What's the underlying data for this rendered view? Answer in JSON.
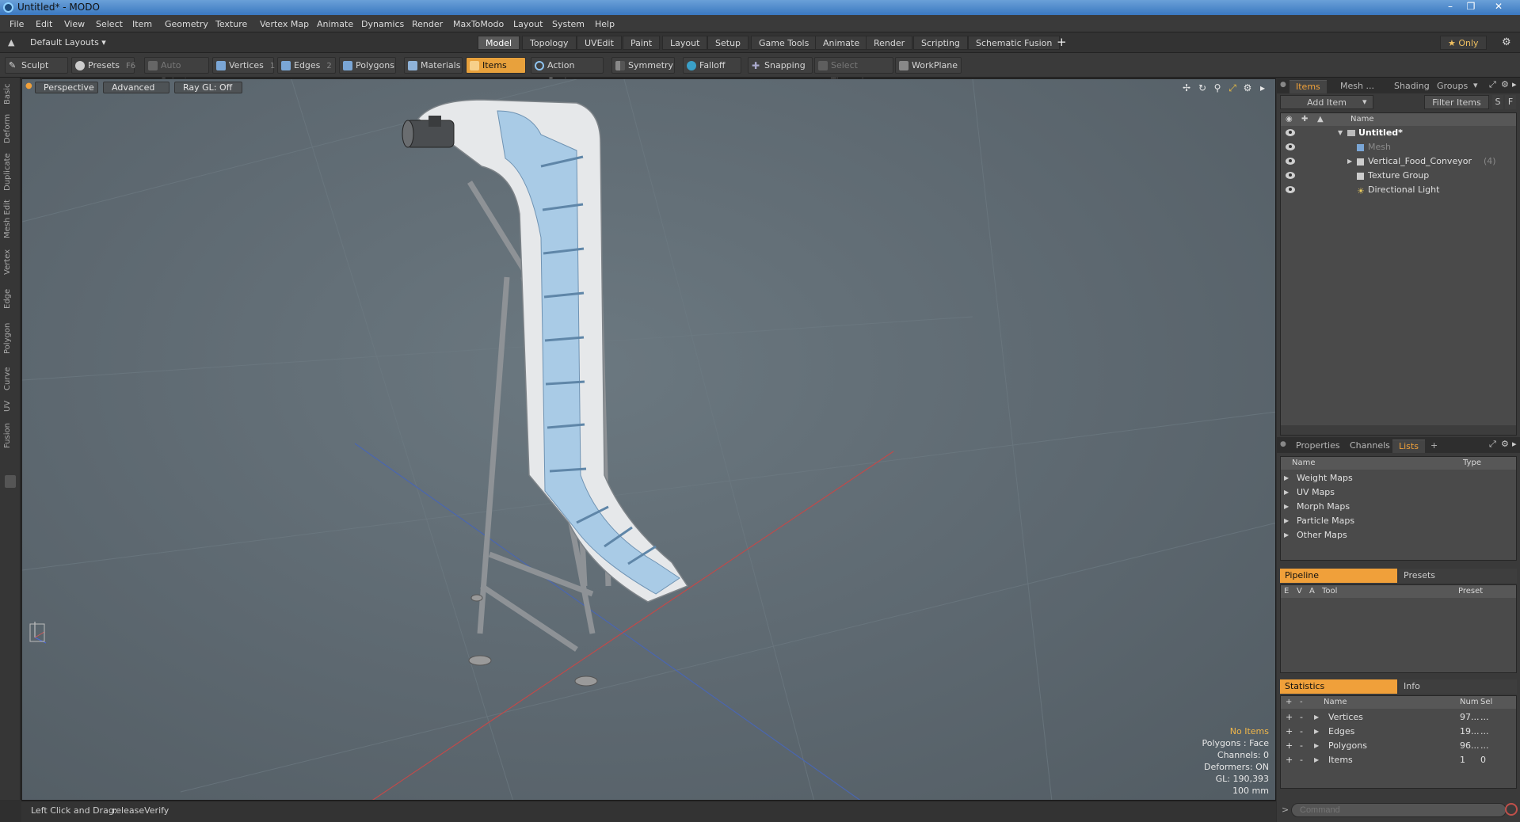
{
  "window": {
    "title": "Untitled* - MODO"
  },
  "menu": [
    "File",
    "Edit",
    "View",
    "Select",
    "Item",
    "Geometry",
    "Texture",
    "Vertex Map",
    "Animate",
    "Dynamics",
    "Render",
    "MaxToModo",
    "Layout",
    "System",
    "Help"
  ],
  "layout": {
    "preset": "Default Layouts ▾",
    "tabs": [
      "Model",
      "Topology",
      "UVEdit",
      "Paint",
      "Layout",
      "Setup",
      "Game Tools",
      "Animate",
      "Render",
      "Scripting",
      "Schematic Fusion"
    ],
    "add": "+",
    "only": "★ Only"
  },
  "toolbar": {
    "sculpt": "Sculpt",
    "presets": "Presets",
    "presets_key": "F6",
    "auto_select": "Auto Select",
    "vertices": "Vertices",
    "vertices_key": "1",
    "edges": "Edges",
    "edges_key": "2",
    "polygons": "Polygons",
    "materials": "Materials",
    "items": "Items",
    "action_center": "Action Center",
    "symmetry": "Symmetry",
    "falloff": "Falloff",
    "snapping": "Snapping",
    "select_through": "Select Through",
    "workplane": "WorkPlane"
  },
  "left_tabs": [
    "Basic",
    "Deform",
    "Duplicate",
    "Mesh Edit",
    "Vertex",
    "Edge",
    "Polygon",
    "Curve",
    "UV",
    "Fusion"
  ],
  "viewport": {
    "view": "Perspective",
    "shading": "Advanced",
    "raygl": "Ray GL: Off",
    "overlay": [
      "No Items",
      "Polygons : Face",
      "Channels: 0",
      "Deformers: ON",
      "GL: 190,393",
      "100 mm"
    ]
  },
  "status": {
    "hint": "Left Click and Drag:",
    "action": "releaseVerify"
  },
  "items_panel": {
    "tabs": [
      "Items",
      "Mesh ...",
      "Shading",
      "Groups"
    ],
    "add_item": "Add Item",
    "filter": "Filter Items",
    "s": "S",
    "f": "F",
    "name_col": "Name",
    "tree": [
      {
        "label": "Untitled*",
        "bold": true,
        "indent": 0
      },
      {
        "label": "Mesh",
        "dim": true,
        "indent": 1
      },
      {
        "label": "Vertical_Food_Conveyor",
        "count": "(4)",
        "indent": 1
      },
      {
        "label": "Texture Group",
        "indent": 1
      },
      {
        "label": "Directional Light",
        "indent": 1
      }
    ]
  },
  "lists_panel": {
    "tabs": [
      "Properties",
      "Channels",
      "Lists",
      "+"
    ],
    "cols": {
      "name": "Name",
      "type": "Type"
    },
    "rows": [
      "Weight Maps",
      "UV Maps",
      "Morph Maps",
      "Particle Maps",
      "Other Maps"
    ]
  },
  "pipeline_panel": {
    "tabs": [
      "Pipeline",
      "Presets"
    ],
    "cols": [
      "E",
      "V",
      "A",
      "Tool",
      "Preset"
    ]
  },
  "stats_panel": {
    "tabs": [
      "Statistics",
      "Info"
    ],
    "cols": [
      "+",
      "-",
      "Name",
      "Num",
      "Sel"
    ],
    "rows": [
      {
        "name": "Vertices",
        "num": "97...",
        "sel": "..."
      },
      {
        "name": "Edges",
        "num": "19...",
        "sel": "..."
      },
      {
        "name": "Polygons",
        "num": "96...",
        "sel": "..."
      },
      {
        "name": "Items",
        "num": "1",
        "sel": "0"
      }
    ]
  },
  "command": {
    "placeholder": "Command"
  },
  "colors": {
    "accent": "#f0a03a",
    "viewport": "#5d6870",
    "belt": "#a9cbe6"
  }
}
